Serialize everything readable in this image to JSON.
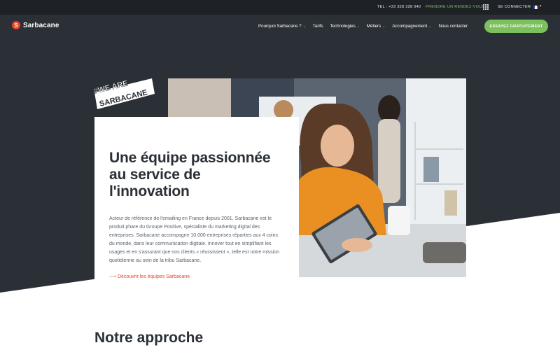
{
  "topbar": {
    "tel": "TEL : +33 328 328 040",
    "appointment": "PRENDRE UN RENDEZ-VOUS",
    "login": "SE CONNECTER",
    "apps_icon": "grid-icon",
    "language_icon": "french-flag-icon"
  },
  "header": {
    "brand": "Sarbacane",
    "logo_letter": "S",
    "nav": [
      {
        "label": "Pourquoi Sarbacane ?",
        "dropdown": true
      },
      {
        "label": "Tarifs",
        "dropdown": false
      },
      {
        "label": "Technologies",
        "dropdown": true
      },
      {
        "label": "Métiers",
        "dropdown": true
      },
      {
        "label": "Accompagnement",
        "dropdown": true
      },
      {
        "label": "Nous contacter",
        "dropdown": false
      }
    ],
    "cta": "ESSAYEZ GRATUITEMENT"
  },
  "hero": {
    "badge_line1": "#WE ARE",
    "badge_line2": "SARBACANE",
    "title": "Une équipe passionnée au service de l'innovation",
    "body": "Acteur de référence de l'emailing en France depuis 2001, Sarbacane est le produit phare du Groupe Positive, spécialiste du marketing digital des entreprises. Sarbacane accompagne 10.000 entreprises réparties aux 4 coins du monde, dans leur communication digitale. Innover tout en simplifiant les usages et en s'assurant que nos clients « réussissent », telle est notre mission quotidienne au sein de la tribu Sarbacane.",
    "link": "⟶ Découvrir les équipes Sarbacane"
  },
  "section": {
    "title": "Notre approche"
  },
  "colors": {
    "dark": "#2b3036",
    "darker": "#1e2227",
    "accent_red": "#e6462d",
    "accent_green": "#7cc15d"
  }
}
